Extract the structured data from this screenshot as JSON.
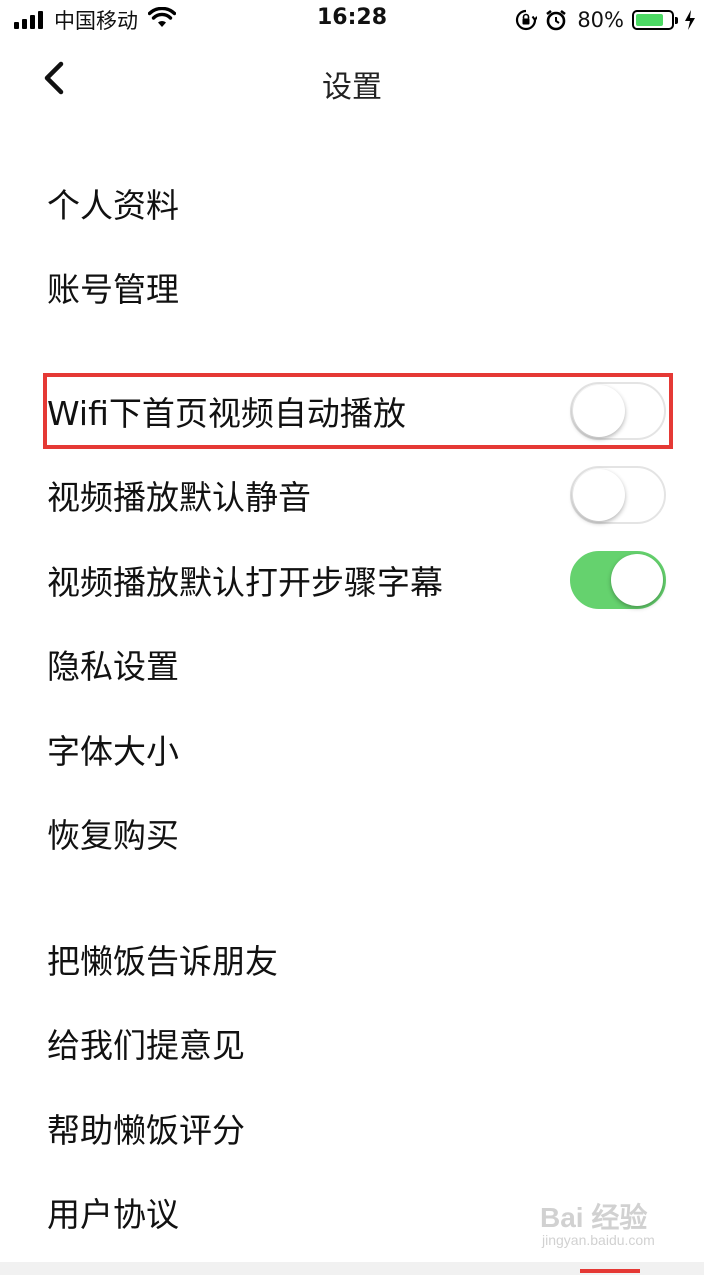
{
  "status_bar": {
    "carrier": "中国移动",
    "time": "16:28",
    "battery_percent": "80%",
    "battery_level": 0.8,
    "icons": [
      "signal-icon",
      "wifi-icon",
      "orientation-lock-icon",
      "alarm-icon",
      "battery-icon",
      "charging-icon"
    ]
  },
  "nav": {
    "title": "设置",
    "back_icon": "chevron-left-icon"
  },
  "settings": {
    "profile": "个人资料",
    "account": "账号管理",
    "wifi_autoplay": {
      "label": "Wifi下首页视频自动播放",
      "enabled": false
    },
    "mute_default": {
      "label": "视频播放默认静音",
      "enabled": false
    },
    "subtitles_default": {
      "label": "视频播放默认打开步骤字幕",
      "enabled": true
    },
    "privacy": "隐私设置",
    "font_size": "字体大小",
    "restore_purchase": "恢复购买",
    "share": "把懒饭告诉朋友",
    "feedback": "给我们提意见",
    "rate": "帮助懒饭评分",
    "agreement": "用户协议"
  },
  "colors": {
    "toggle_on": "#65d26e",
    "highlight": "#e53935",
    "battery": "#4cd964"
  },
  "watermark": {
    "main": "Bai 经验",
    "sub": "jingyan.baidu.com"
  }
}
